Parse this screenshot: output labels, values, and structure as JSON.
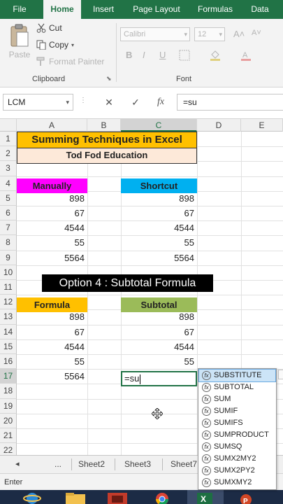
{
  "ribbon": {
    "tabs": [
      "File",
      "Home",
      "Insert",
      "Page Layout",
      "Formulas",
      "Data"
    ],
    "active_tab": "Home",
    "clipboard": {
      "paste": "Paste",
      "cut": "Cut",
      "copy": "Copy",
      "format_painter": "Format Painter",
      "group_label": "Clipboard"
    },
    "font": {
      "name": "Calibri",
      "size": "12",
      "group_label": "Font",
      "bold": "B",
      "italic": "I",
      "underline": "U",
      "grow": "A˄",
      "shrink": "A˅"
    }
  },
  "formula_bar": {
    "name_box": "LCM",
    "cancel": "✕",
    "enter": "✓",
    "fx": "fx",
    "value": "=su"
  },
  "grid": {
    "columns": [
      "A",
      "B",
      "C",
      "D",
      "E"
    ],
    "selected_column": "C",
    "rows": [
      "1",
      "2",
      "3",
      "4",
      "5",
      "6",
      "7",
      "8",
      "9",
      "10",
      "11",
      "12",
      "13",
      "14",
      "15",
      "16",
      "17",
      "18",
      "19",
      "20",
      "21",
      "22"
    ],
    "selected_row": "17",
    "title": "Summing Techniques in Excel",
    "subtitle": "Tod Fod Education",
    "manually_header": "Manually",
    "shortcut_header": "Shortcut",
    "manually_values": [
      "898",
      "67",
      "4544",
      "55",
      "5564"
    ],
    "shortcut_values": [
      "898",
      "67",
      "4544",
      "55",
      "5564"
    ],
    "option_banner": "Option 4 : Subtotal Formula",
    "formula_header": "Formula",
    "subtotal_header": "Subtotal",
    "formula_values": [
      "898",
      "67",
      "4544",
      "55",
      "5564"
    ],
    "subtotal_values": [
      "898",
      "67",
      "4544",
      "55"
    ],
    "active_cell_value": "=su",
    "colors": {
      "title_fill": "#ffc000",
      "subtitle_fill": "#fde9d9",
      "manually_fill": "#ff00ff",
      "shortcut_fill": "#00b0f0",
      "formula_fill": "#ffc000",
      "subtotal_fill": "#9bbb59"
    }
  },
  "autocomplete": {
    "items": [
      "SUBSTITUTE",
      "SUBTOTAL",
      "SUM",
      "SUMIF",
      "SUMIFS",
      "SUMPRODUCT",
      "SUMSQ",
      "SUMX2MY2",
      "SUMX2PY2",
      "SUMXMY2"
    ],
    "selected_index": 0
  },
  "sheet_tabs": {
    "nav_prev": "◂",
    "nav_more": "...",
    "tabs": [
      "Sheet2",
      "Sheet3",
      "Sheet7"
    ]
  },
  "status_bar": {
    "mode": "Enter"
  },
  "taskbar": {
    "apps": [
      "internet-explorer-icon",
      "file-explorer-icon",
      "media-icon",
      "chrome-icon",
      "excel-icon",
      "powerpoint-icon"
    ]
  }
}
